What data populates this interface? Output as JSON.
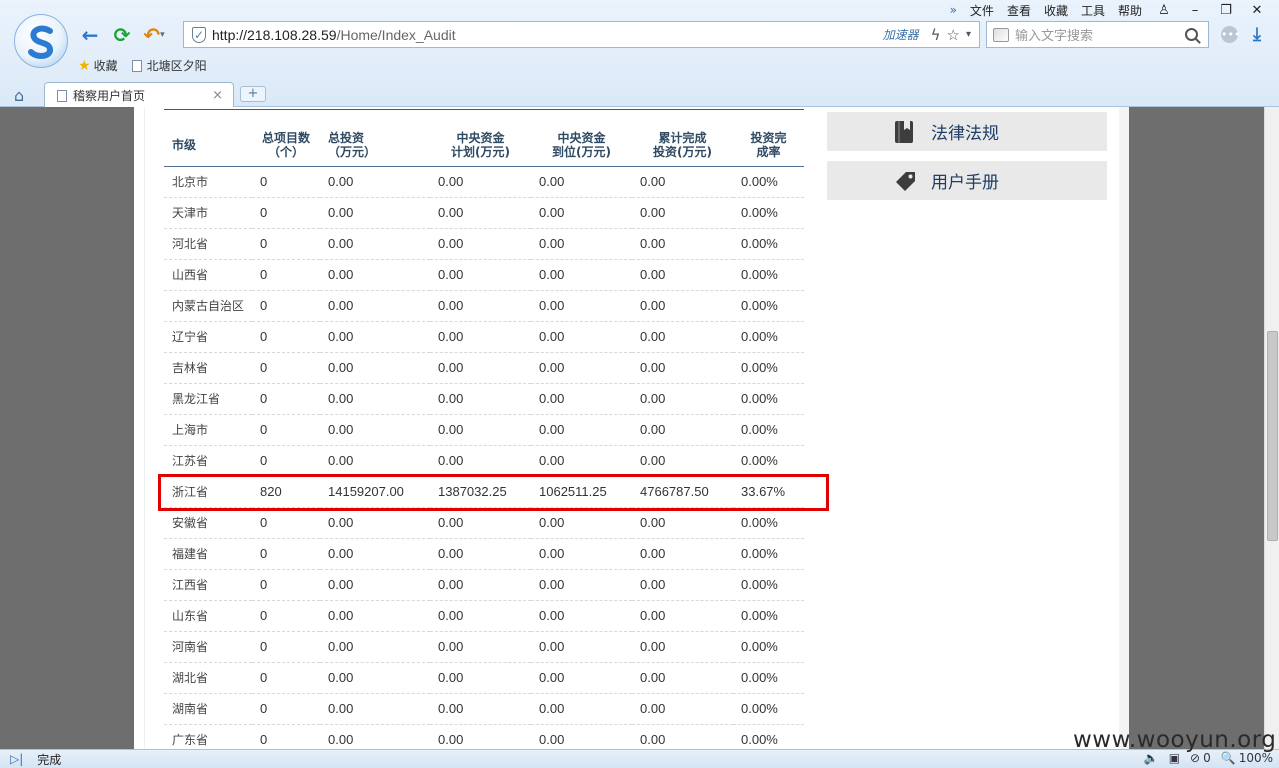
{
  "browser": {
    "menu": [
      "文件",
      "查看",
      "收藏",
      "工具",
      "帮助"
    ],
    "address": {
      "host": "http://218.108.28.59",
      "path": "/Home/Index_Audit",
      "accelerator": "加速器"
    },
    "search_placeholder": "输入文字搜索",
    "favorites": [
      {
        "label": "收藏"
      },
      {
        "label": "北塘区夕阳"
      }
    ],
    "tab": {
      "title": "稽察用户首页",
      "close": "×",
      "new": "+"
    }
  },
  "table": {
    "headers": [
      {
        "line1": "市级",
        "line2": ""
      },
      {
        "line1": "总项目数",
        "line2": "（个）"
      },
      {
        "line1": "总投资",
        "line2": "（万元）"
      },
      {
        "line1": "中央资金",
        "line2": "计划(万元)"
      },
      {
        "line1": "中央资金",
        "line2": "到位(万元)"
      },
      {
        "line1": "累计完成",
        "line2": "投资(万元)"
      },
      {
        "line1": "投资完",
        "line2": "成率"
      }
    ],
    "rows": [
      [
        "北京市",
        "0",
        "0.00",
        "0.00",
        "0.00",
        "0.00",
        "0.00%"
      ],
      [
        "天津市",
        "0",
        "0.00",
        "0.00",
        "0.00",
        "0.00",
        "0.00%"
      ],
      [
        "河北省",
        "0",
        "0.00",
        "0.00",
        "0.00",
        "0.00",
        "0.00%"
      ],
      [
        "山西省",
        "0",
        "0.00",
        "0.00",
        "0.00",
        "0.00",
        "0.00%"
      ],
      [
        "内蒙古自治区",
        "0",
        "0.00",
        "0.00",
        "0.00",
        "0.00",
        "0.00%"
      ],
      [
        "辽宁省",
        "0",
        "0.00",
        "0.00",
        "0.00",
        "0.00",
        "0.00%"
      ],
      [
        "吉林省",
        "0",
        "0.00",
        "0.00",
        "0.00",
        "0.00",
        "0.00%"
      ],
      [
        "黑龙江省",
        "0",
        "0.00",
        "0.00",
        "0.00",
        "0.00",
        "0.00%"
      ],
      [
        "上海市",
        "0",
        "0.00",
        "0.00",
        "0.00",
        "0.00",
        "0.00%"
      ],
      [
        "江苏省",
        "0",
        "0.00",
        "0.00",
        "0.00",
        "0.00",
        "0.00%"
      ],
      [
        "浙江省",
        "820",
        "14159207.00",
        "1387032.25",
        "1062511.25",
        "4766787.50",
        "33.67%"
      ],
      [
        "安徽省",
        "0",
        "0.00",
        "0.00",
        "0.00",
        "0.00",
        "0.00%"
      ],
      [
        "福建省",
        "0",
        "0.00",
        "0.00",
        "0.00",
        "0.00",
        "0.00%"
      ],
      [
        "江西省",
        "0",
        "0.00",
        "0.00",
        "0.00",
        "0.00",
        "0.00%"
      ],
      [
        "山东省",
        "0",
        "0.00",
        "0.00",
        "0.00",
        "0.00",
        "0.00%"
      ],
      [
        "河南省",
        "0",
        "0.00",
        "0.00",
        "0.00",
        "0.00",
        "0.00%"
      ],
      [
        "湖北省",
        "0",
        "0.00",
        "0.00",
        "0.00",
        "0.00",
        "0.00%"
      ],
      [
        "湖南省",
        "0",
        "0.00",
        "0.00",
        "0.00",
        "0.00",
        "0.00%"
      ],
      [
        "广东省",
        "0",
        "0.00",
        "0.00",
        "0.00",
        "0.00",
        "0.00%"
      ]
    ],
    "highlight_color": "#e00000"
  },
  "sidebar": {
    "law_label": "法律法规",
    "manual_label": "用户手册"
  },
  "status": {
    "text": "完成",
    "count": "0",
    "zoom": "100%"
  },
  "watermark": "www.wooyun.org"
}
